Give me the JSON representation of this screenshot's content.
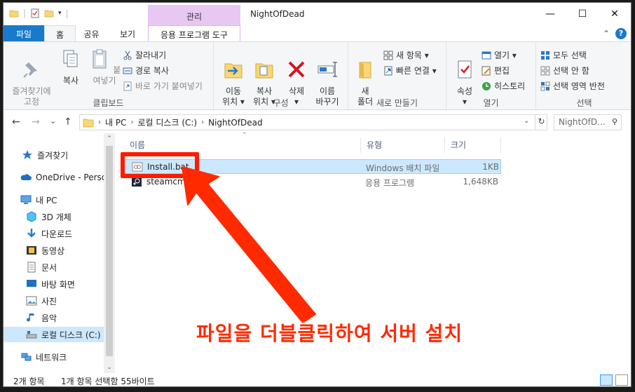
{
  "window": {
    "title": "NightOfDead",
    "contextual_tab": "관리",
    "controls": {
      "minimize": "—",
      "maximize": "☐",
      "close": "✕"
    }
  },
  "tabs": {
    "file": "파일",
    "home": "홈",
    "share": "공유",
    "view": "보기",
    "app_tools": "응용 프로그램 도구",
    "collapse": "⌃",
    "help": "?"
  },
  "ribbon": {
    "clipboard": {
      "label": "클립보드",
      "pin": "즐겨찾기에\n고정",
      "copy": "복사",
      "paste": "붙여넣기",
      "cut": "잘라내기",
      "copy_path": "경로 복사",
      "paste_shortcut": "바로 가기 붙여넣기"
    },
    "organize": {
      "label": "구성",
      "move_to": "이동\n위치 ▾",
      "copy_to": "복사\n위치 ▾",
      "delete": "삭제\n▾",
      "rename": "이름\n바꾸기"
    },
    "new": {
      "label": "새로 만들기",
      "new_folder": "새\n폴더",
      "new_item": "새 항목 ▾",
      "easy_access": "빠른 연결 ▾"
    },
    "open": {
      "label": "열기",
      "properties": "속성\n▾",
      "open": "열기 ▾",
      "edit": "편집",
      "history": "히스토리"
    },
    "select": {
      "label": "선택",
      "select_all": "모두 선택",
      "select_none": "선택 안 함",
      "invert": "선택 영역 반전"
    }
  },
  "address": {
    "back": "←",
    "forward": "→",
    "recent": "⌄",
    "up": "↑",
    "segments": [
      "내 PC",
      "로컬 디스크 (C:)",
      "NightOfDead"
    ],
    "separator": "›",
    "dropdown": "⌄",
    "refresh": "↻",
    "search_placeholder": "NightOfD...",
    "search_glyph": "⚲"
  },
  "nav": {
    "items": [
      {
        "label": "즐겨찾기",
        "icon": "star-icon"
      },
      {
        "label": "OneDrive - Person",
        "icon": "cloud-icon"
      },
      {
        "label": "내 PC",
        "icon": "pc-icon"
      },
      {
        "label": "3D 개체",
        "icon": "cube-icon"
      },
      {
        "label": "다운로드",
        "icon": "download-icon"
      },
      {
        "label": "동영상",
        "icon": "video-icon"
      },
      {
        "label": "문서",
        "icon": "document-icon"
      },
      {
        "label": "바탕 화면",
        "icon": "desktop-icon"
      },
      {
        "label": "사진",
        "icon": "picture-icon"
      },
      {
        "label": "음악",
        "icon": "music-icon"
      },
      {
        "label": "로컬 디스크 (C:)",
        "icon": "drive-icon",
        "selected": true
      },
      {
        "label": "네트워크",
        "icon": "network-icon"
      }
    ],
    "scroll_up": "⌃",
    "scroll_down": "⌄"
  },
  "columns": {
    "name": "이름",
    "type": "유형",
    "size": "크기",
    "sort": "⌃"
  },
  "files": [
    {
      "name": "Install.bat",
      "type": "Windows 배치 파일",
      "size": "1KB",
      "selected": true
    },
    {
      "name": "steamcmd.exe",
      "type": "응용 프로그램",
      "size": "1,648KB",
      "selected": false
    }
  ],
  "status": {
    "count": "2개 항목",
    "selection": "1개 항목 선택함 55바이트"
  },
  "annotation": {
    "text": "파일을 더블클릭하여 서버 설치",
    "color": "#ff2a00"
  },
  "colors": {
    "file_tab": "#1979ca",
    "manage_tab": "#e8c7f3",
    "selection": "#cce8ff",
    "annotation_red": "#ff1a00"
  }
}
